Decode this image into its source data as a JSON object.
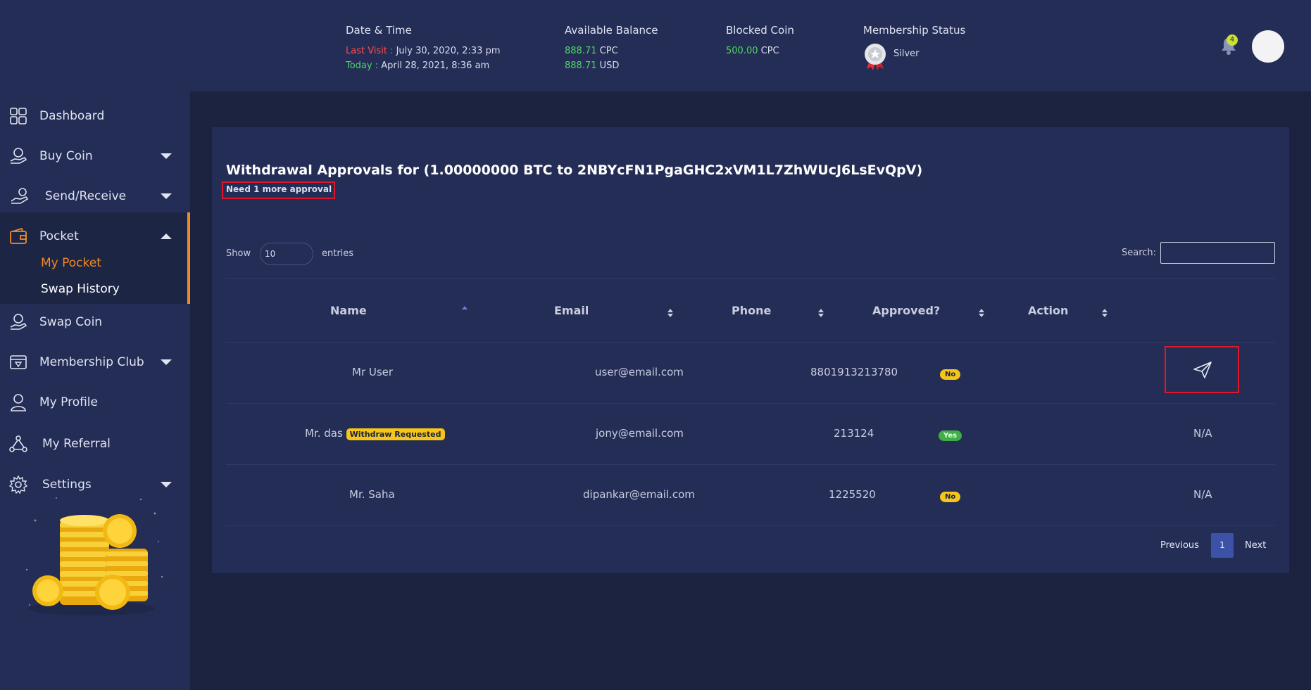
{
  "header": {
    "date_time": {
      "label": "Date & Time",
      "last_visit_label": "Last Visit :",
      "last_visit_value": "July 30, 2020, 2:33 pm",
      "today_label": "Today :",
      "today_value": "April 28, 2021, 8:36 am"
    },
    "available_balance": {
      "label": "Available Balance",
      "cpc_amount": "888.71",
      "cpc_unit": "CPC",
      "usd_amount": "888.71",
      "usd_unit": "USD"
    },
    "blocked_coin": {
      "label": "Blocked Coin",
      "amount": "500.00",
      "unit": "CPC"
    },
    "membership": {
      "label": "Membership Status",
      "tier": "Silver",
      "icon": "medal-icon"
    },
    "notifications": {
      "count": "4",
      "icon": "bell-icon"
    }
  },
  "sidebar": {
    "items": [
      {
        "label": "Dashboard",
        "icon": "dashboard-icon"
      },
      {
        "label": "Buy Coin",
        "icon": "coin-hand-icon"
      },
      {
        "label": "Send/Receive",
        "icon": "send-receive-icon"
      },
      {
        "label": "Pocket",
        "icon": "wallet-icon"
      },
      {
        "label": "Swap Coin",
        "icon": "swap-coin-icon"
      },
      {
        "label": "Membership Club",
        "icon": "membership-icon"
      },
      {
        "label": "My Profile",
        "icon": "profile-icon"
      },
      {
        "label": "My Referral",
        "icon": "referral-icon"
      },
      {
        "label": "Settings",
        "icon": "gear-icon"
      }
    ],
    "pocket_sub": [
      {
        "label": "My Pocket"
      },
      {
        "label": "Swap History"
      }
    ]
  },
  "main": {
    "title": "Withdrawal Approvals for (1.00000000 BTC to 2NBYcFN1PgaGHC2xVM1L7ZhWUcJ6LsEvQpV)",
    "need_text": "Need 1 more approval",
    "show_label": "Show",
    "entries_value": "10",
    "entries_label": "entries",
    "search_label": "Search:",
    "search_value": "",
    "columns": [
      "Name",
      "Email",
      "Phone",
      "Approved?",
      "Action"
    ],
    "rows": [
      {
        "name": "Mr User",
        "tag": "",
        "email": "user@email.com",
        "phone": "8801913213780",
        "approved": "No",
        "action": "send-icon"
      },
      {
        "name": "Mr. das",
        "tag": "Withdraw Requested",
        "email": "jony@email.com",
        "phone": "213124",
        "approved": "Yes",
        "action": "N/A"
      },
      {
        "name": "Mr. Saha",
        "tag": "",
        "email": "dipankar@email.com",
        "phone": "1225520",
        "approved": "No",
        "action": "N/A"
      }
    ],
    "pagination": {
      "prev": "Previous",
      "current": "1",
      "next": "Next"
    }
  },
  "colors": {
    "background": "#1b2340",
    "panel": "#242d55",
    "accent_orange": "#f08a24",
    "highlight_red": "#e0162b",
    "badge_yellow": "#f5c518",
    "badge_green": "#3fae49",
    "page_blue": "#3b52a8"
  }
}
